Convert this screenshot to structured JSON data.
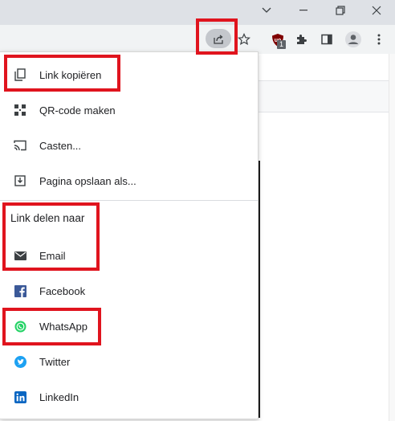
{
  "share_menu": {
    "items": [
      {
        "label": "Link kopiëren",
        "icon": "copy-icon"
      },
      {
        "label": "QR-code maken",
        "icon": "qr-code-icon"
      },
      {
        "label": "Casten...",
        "icon": "cast-icon"
      },
      {
        "label": "Pagina opslaan als...",
        "icon": "download-icon"
      }
    ],
    "share_section_label": "Link delen naar",
    "share_targets": [
      {
        "label": "Email",
        "icon": "email-icon"
      },
      {
        "label": "Facebook",
        "icon": "facebook-icon",
        "color": "#3b5998"
      },
      {
        "label": "WhatsApp",
        "icon": "whatsapp-icon",
        "color": "#25d366"
      },
      {
        "label": "Twitter",
        "icon": "twitter-icon",
        "color": "#1da1f2"
      },
      {
        "label": "LinkedIn",
        "icon": "linkedin-icon",
        "color": "#0a66c2"
      }
    ]
  },
  "toolbar": {
    "extension_badge": "1"
  },
  "colors": {
    "highlight": "#e0141e",
    "titlebar": "#dee1e6",
    "toolbar": "#f1f3f4"
  }
}
